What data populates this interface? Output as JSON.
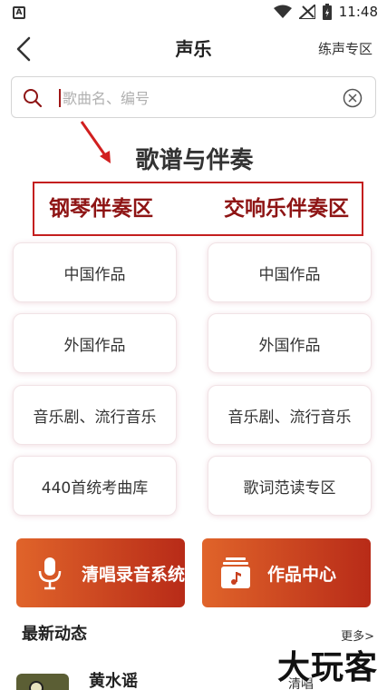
{
  "status_bar": {
    "time": "11:48",
    "left_icon": "A"
  },
  "nav": {
    "title": "声乐",
    "right_link": "练声专区"
  },
  "search": {
    "placeholder": "歌曲名、编号",
    "value": ""
  },
  "section": {
    "title": "歌谱与伴奏"
  },
  "zones": {
    "piano": "钢琴伴奏区",
    "symphony": "交响乐伴奏区"
  },
  "grid": {
    "left": [
      "中国作品",
      "外国作品",
      "音乐剧、流行音乐",
      "440首统考曲库"
    ],
    "right": [
      "中国作品",
      "外国作品",
      "音乐剧、流行音乐",
      "歌词范读专区"
    ]
  },
  "actions": {
    "record": "清唱录音系统",
    "works": "作品中心"
  },
  "news": {
    "title": "最新动态",
    "more": "更多>"
  },
  "news_item": {
    "title": "黄水谣",
    "tag": "清唱"
  },
  "watermark": "大玩客",
  "colors": {
    "accent": "#c41f1f",
    "zone_text": "#8e1414",
    "button_gradient_start": "#e0642a",
    "button_gradient_end": "#b82b18"
  },
  "icons": [
    "back-arrow-icon",
    "search-icon",
    "clear-icon",
    "microphone-icon",
    "music-album-icon",
    "wifi-icon",
    "signal-icon",
    "battery-icon"
  ]
}
